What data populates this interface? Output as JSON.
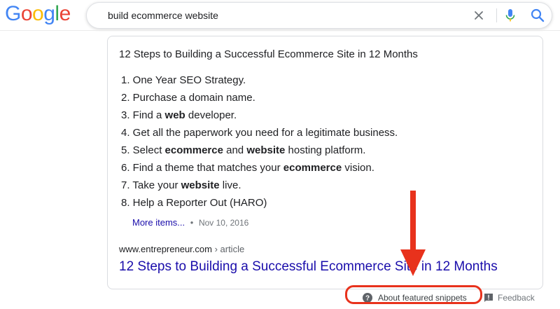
{
  "brand": {
    "logo_letters": [
      "G",
      "o",
      "o",
      "g",
      "l",
      "e"
    ],
    "logo_colors": [
      "#4285F4",
      "#EA4335",
      "#FBBC05",
      "#4285F4",
      "#34A853",
      "#EA4335"
    ]
  },
  "search": {
    "query": "build ecommerce website"
  },
  "snippet": {
    "title": "12 Steps to Building a Successful Ecommerce Site in 12 Months",
    "steps": [
      [
        {
          "t": "1. One Year SEO Strategy.",
          "b": false
        }
      ],
      [
        {
          "t": "2. Purchase a domain name.",
          "b": false
        }
      ],
      [
        {
          "t": "3. Find a ",
          "b": false
        },
        {
          "t": "web",
          "b": true
        },
        {
          "t": " developer.",
          "b": false
        }
      ],
      [
        {
          "t": "4. Get all the paperwork you need for a legitimate business.",
          "b": false
        }
      ],
      [
        {
          "t": "5. Select ",
          "b": false
        },
        {
          "t": "ecommerce",
          "b": true
        },
        {
          "t": " and ",
          "b": false
        },
        {
          "t": "website",
          "b": true
        },
        {
          "t": " hosting platform.",
          "b": false
        }
      ],
      [
        {
          "t": "6. Find a theme that matches your ",
          "b": false
        },
        {
          "t": "ecommerce",
          "b": true
        },
        {
          "t": " vision.",
          "b": false
        }
      ],
      [
        {
          "t": "7. Take your ",
          "b": false
        },
        {
          "t": "website",
          "b": true
        },
        {
          "t": " live.",
          "b": false
        }
      ],
      [
        {
          "t": "8. Help a Reporter Out (HARO)",
          "b": false
        }
      ]
    ],
    "more_items": "More items...",
    "separator": "•",
    "date": "Nov 10, 2016",
    "cite_domain": "www.entrepreneur.com",
    "cite_path": " › article",
    "link_title": "12 Steps to Building a Successful Ecommerce Site in 12 Months"
  },
  "footer": {
    "about_label": "About featured snippets",
    "feedback_label": "Feedback"
  },
  "colors": {
    "link": "#1a0dab",
    "annotation": "#e8321c"
  },
  "icons": [
    "clear-icon",
    "mic-icon",
    "search-icon",
    "help-circle-icon",
    "feedback-icon",
    "annotation-arrow"
  ]
}
